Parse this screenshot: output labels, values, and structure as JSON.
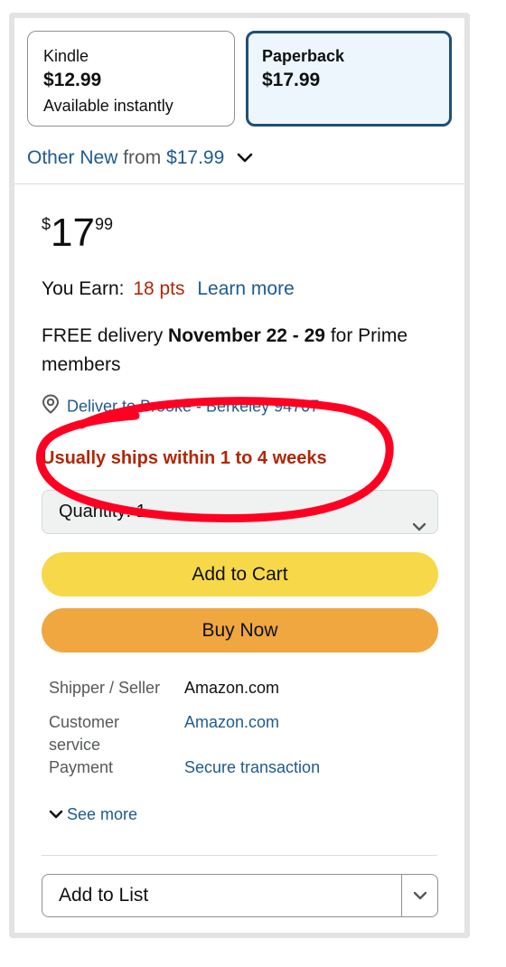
{
  "formats": [
    {
      "name": "Kindle",
      "price": "$12.99",
      "availability": "Available instantly",
      "selected": false
    },
    {
      "name": "Paperback",
      "price": "$17.99",
      "availability": "",
      "selected": true
    }
  ],
  "other_new": {
    "link_text": "Other New",
    "from_text": "from",
    "price": "$17.99"
  },
  "price": {
    "symbol": "$",
    "whole": "17",
    "fraction": "99"
  },
  "earn": {
    "label": "You Earn:",
    "points": "18 pts",
    "learn_more": "Learn more"
  },
  "delivery": {
    "prefix": "FREE delivery",
    "dates": "November 22 - 29",
    "suffix": "for Prime members"
  },
  "deliver_to": "Deliver to Brooke - Berkeley 94707",
  "availability_message": "Usually ships within 1 to 4 weeks",
  "quantity": {
    "label": "Quantity:",
    "value": "1"
  },
  "buttons": {
    "add_to_cart": "Add to Cart",
    "buy_now": "Buy Now"
  },
  "seller_info": [
    {
      "label": "Shipper / Seller",
      "value": "Amazon.com",
      "is_link": false
    },
    {
      "label": "Customer service",
      "value": "Amazon.com",
      "is_link": true
    },
    {
      "label": "Payment",
      "value": "Secure transaction",
      "is_link": true
    }
  ],
  "see_more": "See more",
  "add_to_list": "Add to List",
  "colors": {
    "link": "#1e5b8f",
    "price_red": "#b12704",
    "cart_button": "#f7d849",
    "buy_button": "#f0a73f",
    "annotation": "#ff0022"
  },
  "icons": {
    "location": "location-pin-icon",
    "chevron": "chevron-down-icon"
  }
}
